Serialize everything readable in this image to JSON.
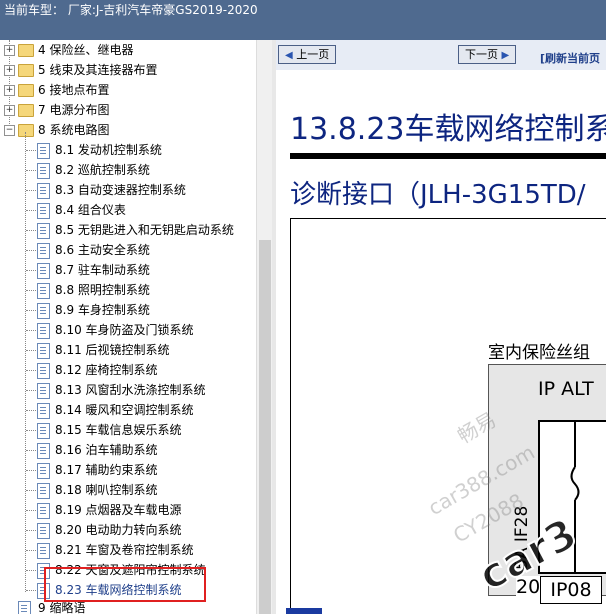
{
  "titlebar": {
    "text": "当前车型： 厂家:J-吉利汽车帝豪GS2019-2020"
  },
  "tree": {
    "folders": [
      {
        "label": "4 保险丝、继电器",
        "expanded": false
      },
      {
        "label": "5 线束及其连接器布置",
        "expanded": false
      },
      {
        "label": "6 接地点布置",
        "expanded": false
      },
      {
        "label": "7 电源分布图",
        "expanded": false
      },
      {
        "label": "8 系统电路图",
        "expanded": true
      }
    ],
    "items": [
      "8.1 发动机控制系统",
      "8.2 巡航控制系统",
      "8.3 自动变速器控制系统",
      "8.4 组合仪表",
      "8.5 无钥匙进入和无钥匙启动系统",
      "8.6 主动安全系统",
      "8.7 驻车制动系统",
      "8.8 照明控制系统",
      "8.9 车身控制系统",
      "8.10 车身防盗及门锁系统",
      "8.11 后视镜控制系统",
      "8.12 座椅控制系统",
      "8.13 风窗刮水洗涤控制系统",
      "8.14 暖风和空调控制系统",
      "8.15 车载信息娱乐系统",
      "8.16 泊车辅助系统",
      "8.17 辅助约束系统",
      "8.18 喇叭控制系统",
      "8.19 点烟器及车载电源",
      "8.20 电动助力转向系统",
      "8.21 车窗及卷帘控制系统",
      "8.22 天窗及遮阳帘控制系统",
      "8.23 车载网络控制系统"
    ],
    "selected": "8.23 车载网络控制系统",
    "last_item": "9 缩略语"
  },
  "nav": {
    "prev_label": "上一页",
    "next_label": "下一页",
    "refresh_label": "[刷新当前页"
  },
  "doc": {
    "title": "13.8.23车载网络控制系",
    "subtitle": "诊断接口（JLH-3G15TD/",
    "fuse_box_title": "室内保险丝组",
    "fuse_name": "IP ALT",
    "fuse_rating": "5A IF28",
    "pin": "20",
    "connector": "IP08",
    "watermark": [
      "畅易",
      "car388.com",
      "CY2088",
      "car3"
    ]
  },
  "colors": {
    "titlebar_bg": "#4f6a8f",
    "heading": "#0d2580",
    "highlight_box": "#e02020"
  }
}
